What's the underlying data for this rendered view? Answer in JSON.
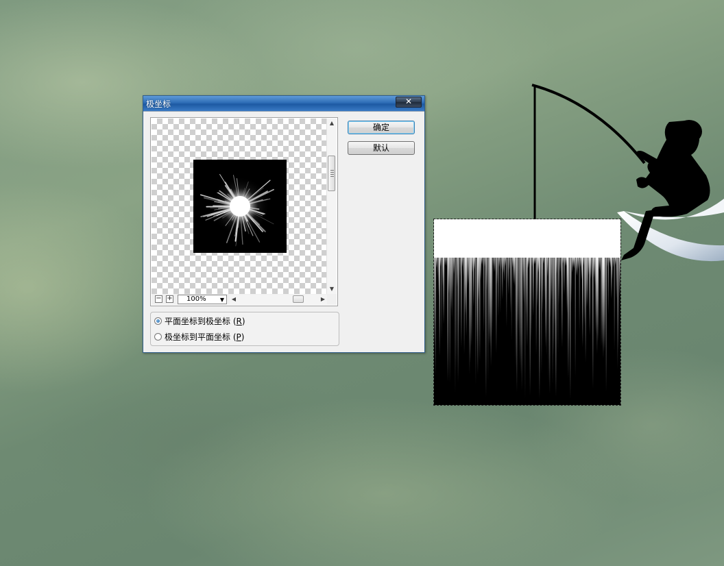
{
  "dialog": {
    "title": "极坐标",
    "close_label": "✕",
    "buttons": {
      "ok": "确定",
      "default": "默认"
    },
    "zoom": {
      "minus": "−",
      "plus": "+",
      "value": "100%"
    },
    "options": [
      {
        "label": "平面坐标到极坐标",
        "accel": "R",
        "checked": true
      },
      {
        "label": "极坐标到平面坐标",
        "accel": "P",
        "checked": false
      }
    ]
  },
  "icons": {
    "scroll_up": "scroll-up-icon",
    "scroll_down": "scroll-down-icon",
    "scroll_left": "scroll-left-icon",
    "scroll_right": "scroll-right-icon",
    "dropdown": "chevron-down-icon"
  },
  "colors": {
    "title_bar": "#2e6db6",
    "default_button_border": "#3c7fb1"
  }
}
